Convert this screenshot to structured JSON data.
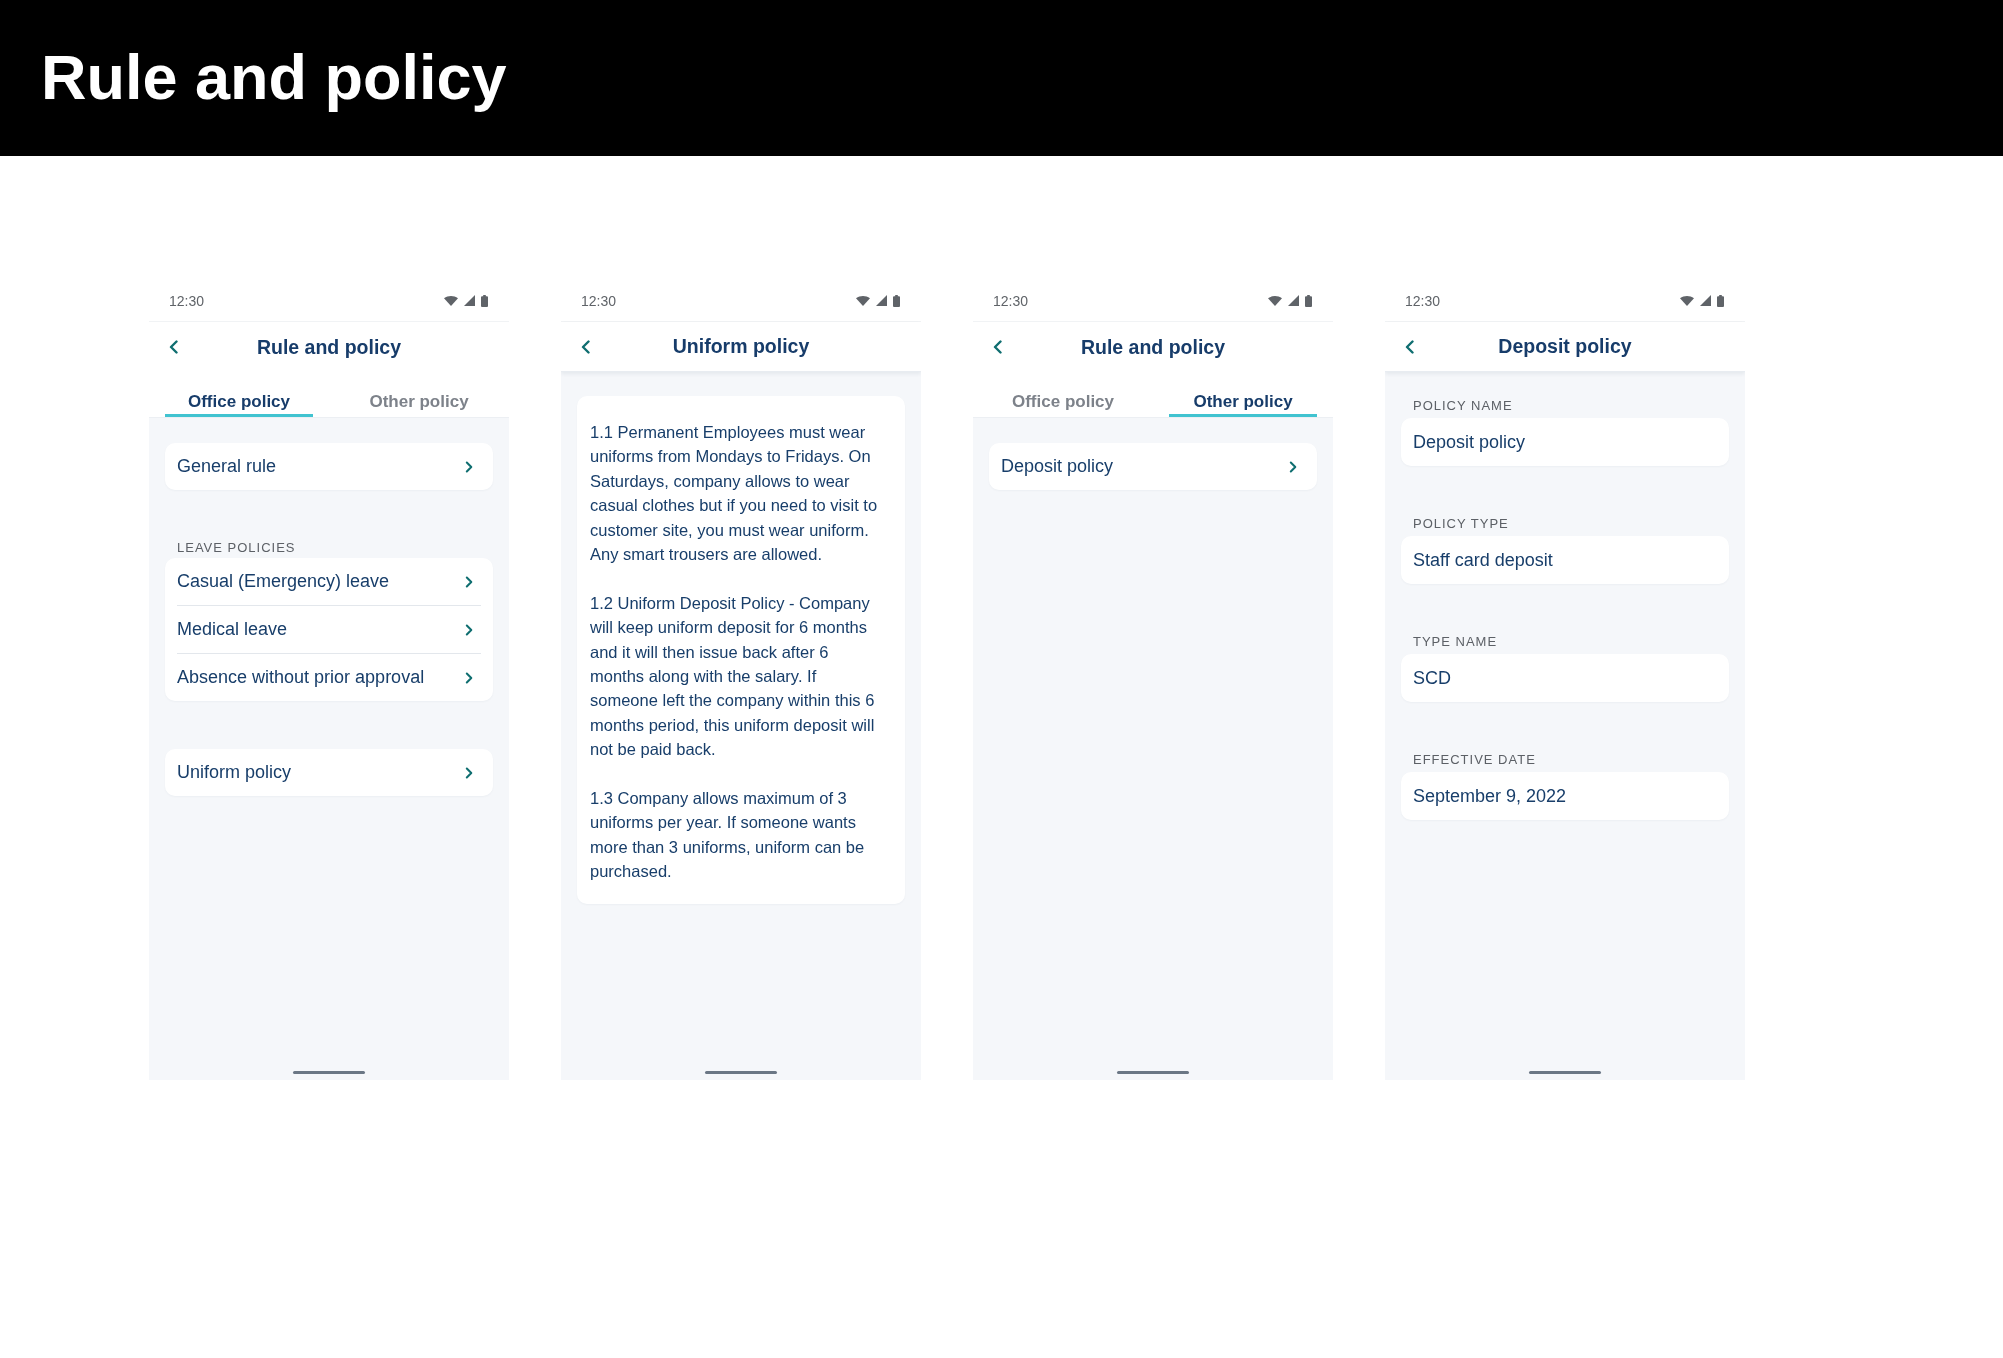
{
  "page_title": "Rule and policy",
  "screens": [
    {
      "kind": "tabbed_list",
      "status_bar": {
        "time": "12:30"
      },
      "app_bar": {
        "title": "Rule and policy"
      },
      "tabs": [
        {
          "label": "Office policy",
          "selected": true
        },
        {
          "label": "Other policy",
          "selected": false
        }
      ],
      "sections": [
        {
          "items": [
            {
              "label": "General rule"
            }
          ]
        },
        {
          "heading": "LEAVE POLICIES",
          "items": [
            {
              "label": "Casual (Emergency) leave"
            },
            {
              "label": "Medical leave"
            },
            {
              "label": "Absence without prior approval"
            }
          ]
        },
        {
          "items": [
            {
              "label": "Uniform policy"
            }
          ]
        }
      ]
    },
    {
      "kind": "document",
      "status_bar": {
        "time": "12:30"
      },
      "app_bar": {
        "title": "Uniform policy"
      },
      "paragraphs": [
        "1.1 Permanent Employees must wear uniforms from Mondays to Fridays. On Saturdays, company allows to wear casual clothes but if you need to visit to customer site, you must wear uniform. Any smart trousers are allowed.",
        "1.2 Uniform Deposit Policy - Company will keep uniform deposit for 6 months and it will then issue back after 6 months along with the salary. If someone left the company within this 6 months period, this uniform deposit will not be paid back.",
        "1.3 Company allows maximum of 3 uniforms per year. If someone wants more than 3 uniforms, uniform can be purchased."
      ]
    },
    {
      "kind": "tabbed_list",
      "status_bar": {
        "time": "12:30"
      },
      "app_bar": {
        "title": "Rule and policy"
      },
      "tabs": [
        {
          "label": "Office policy",
          "selected": false
        },
        {
          "label": "Other policy",
          "selected": true
        }
      ],
      "sections": [
        {
          "items": [
            {
              "label": "Deposit policy"
            }
          ]
        }
      ]
    },
    {
      "kind": "details",
      "status_bar": {
        "time": "12:30"
      },
      "app_bar": {
        "title": "Deposit policy"
      },
      "fields": [
        {
          "label": "POLICY NAME",
          "value": "Deposit policy"
        },
        {
          "label": "POLICY TYPE",
          "value": "Staff card deposit"
        },
        {
          "label": "TYPE NAME",
          "value": "SCD"
        },
        {
          "label": "EFFECTIVE DATE",
          "value": "September 9, 2022"
        }
      ]
    }
  ]
}
